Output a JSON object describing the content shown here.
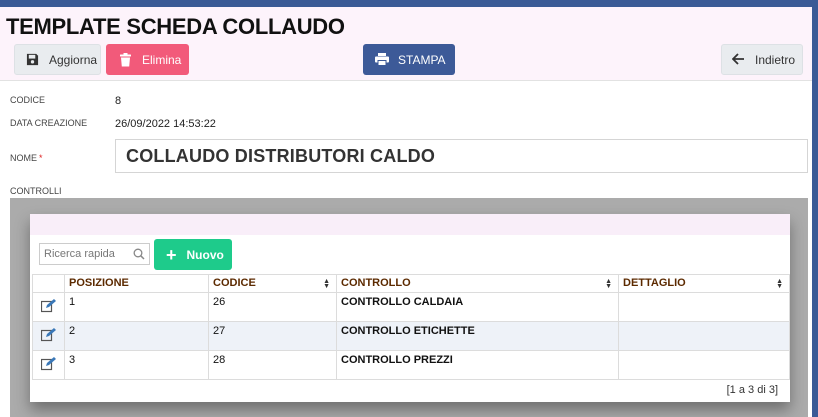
{
  "page": {
    "title": "TEMPLATE SCHEDA COLLAUDO"
  },
  "toolbar": {
    "update_label": "Aggiorna",
    "delete_label": "Elimina",
    "print_label": "STAMPA",
    "back_label": "Indietro",
    "update_icon": "floppy-disk-icon",
    "delete_icon": "trash-icon",
    "print_icon": "printer-icon",
    "back_icon": "arrow-left-icon",
    "colors": {
      "delete": "#f25a7a",
      "print": "#3d5a98",
      "new": "#1ecb8b"
    }
  },
  "form": {
    "codice_label": "CODICE",
    "codice_value": "8",
    "data_label": "DATA CREAZIONE",
    "data_value": "26/09/2022 14:53:22",
    "nome_label": "NOME",
    "nome_required": "*",
    "nome_value": "COLLAUDO DISTRIBUTORI CALDO",
    "controlli_label": "CONTROLLI"
  },
  "controlli": {
    "search_placeholder": "Ricerca rapida",
    "new_label": "Nuovo",
    "columns": [
      "POSIZIONE",
      "CODICE",
      "CONTROLLO",
      "DETTAGLIO"
    ],
    "rows": [
      {
        "posizione": "1",
        "codice": "26",
        "controllo": "CONTROLLO CALDAIA",
        "dettaglio": ""
      },
      {
        "posizione": "2",
        "codice": "27",
        "controllo": "CONTROLLO ETICHETTE",
        "dettaglio": ""
      },
      {
        "posizione": "3",
        "codice": "28",
        "controllo": "CONTROLLO PREZZI",
        "dettaglio": ""
      }
    ],
    "pager": "[1 a 3 di 3]"
  }
}
